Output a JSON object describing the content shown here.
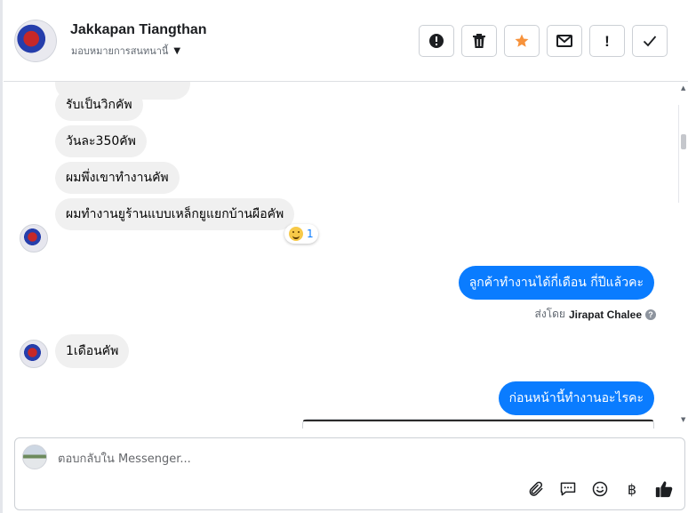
{
  "header": {
    "contact_name": "Jakkapan Tiangthan",
    "assign_label": "มอบหมายการสนทนานี้",
    "actions": [
      {
        "name": "spam-button",
        "icon": "alert-circle-icon"
      },
      {
        "name": "delete-button",
        "icon": "trash-icon"
      },
      {
        "name": "star-button",
        "icon": "star-icon",
        "color": "#f7923b"
      },
      {
        "name": "mail-button",
        "icon": "envelope-icon"
      },
      {
        "name": "flag-button",
        "icon": "exclamation-icon",
        "label": "!"
      },
      {
        "name": "done-button",
        "icon": "check-icon"
      }
    ]
  },
  "messages": {
    "in_1": "รับเป็นวิกคัพ",
    "in_2": "วันละ350คัพ",
    "in_3": "ผมพึ่งเขาทำงานคัพ",
    "in_4": "ผมทำงานยูร้านแบบเหล็กยูแยกบ้านผือคัพ",
    "reaction_count": "1",
    "out_1": "ลูกค้าทำงานได้กี่เดือน กี่ปีแล้วคะ",
    "sent_by_prefix": "ส่งโดย",
    "sent_by_name": "Jirapat Chalee",
    "in_5": "1เดือนคัพ",
    "out_2": "ก่อนหน้านี้ทำงานอะไรคะ"
  },
  "composer": {
    "placeholder": "ตอบกลับใน Messenger...",
    "baht_symbol": "฿",
    "tools": [
      "paperclip-icon",
      "saved-reply-icon",
      "emoji-icon",
      "baht-icon",
      "thumbs-up-icon"
    ]
  },
  "colors": {
    "outgoing_bubble": "#0a7cff",
    "incoming_bubble": "#f0f0f0",
    "star": "#f7923b"
  }
}
